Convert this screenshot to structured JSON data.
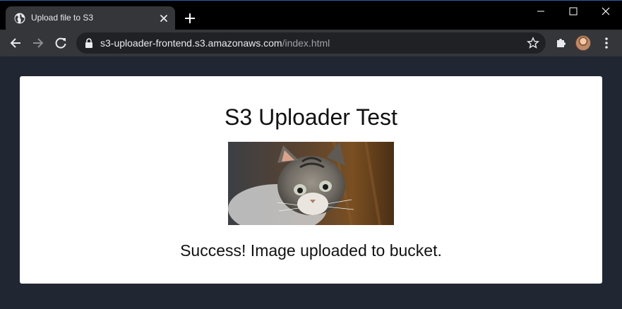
{
  "browser": {
    "tab": {
      "title": "Upload file to S3",
      "favicon": "globe-icon"
    },
    "address_bar": {
      "host": "s3-uploader-frontend.s3.amazonaws.com",
      "path": "/index.html"
    },
    "icons": [
      "back-arrow-icon",
      "forward-arrow-icon",
      "reload-icon",
      "lock-icon",
      "star-icon",
      "puzzle-icon",
      "kebab-menu-icon",
      "minimize-icon",
      "maximize-icon",
      "close-icon",
      "plus-icon"
    ]
  },
  "page": {
    "heading": "S3 Uploader Test",
    "image_subject": "kitten photo",
    "status_message": "Success! Image uploaded to bucket."
  },
  "colors": {
    "titlebar": "#000000",
    "toolbar": "#35363a",
    "omnibox": "#202124",
    "page_bg": "#202632",
    "card_bg": "#ffffff"
  }
}
